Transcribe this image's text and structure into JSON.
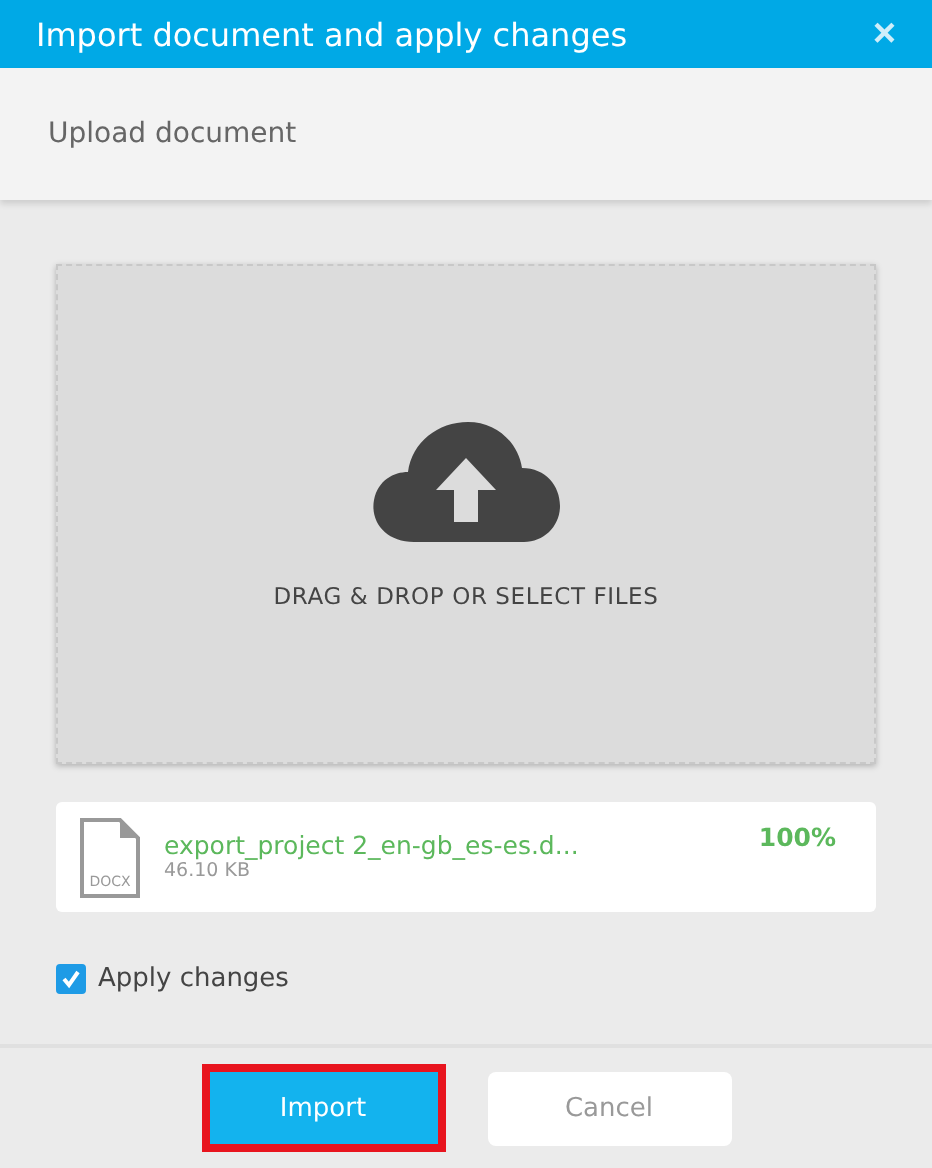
{
  "window": {
    "title": "Import document and apply changes",
    "close": "×"
  },
  "section_title": "Upload document",
  "dropzone": {
    "label": "DRAG & DROP OR SELECT FILES"
  },
  "file": {
    "type": "DOCX",
    "name": "export_project 2_en-gb_es-es.d...",
    "size": "46.10 KB",
    "progress": "100%"
  },
  "apply_changes": {
    "label": "Apply changes",
    "checked": true
  },
  "buttons": [
    {
      "label": "Import",
      "kind": "primary",
      "highlighted": true
    },
    {
      "label": "Cancel",
      "kind": "secondary",
      "highlighted": false
    }
  ]
}
